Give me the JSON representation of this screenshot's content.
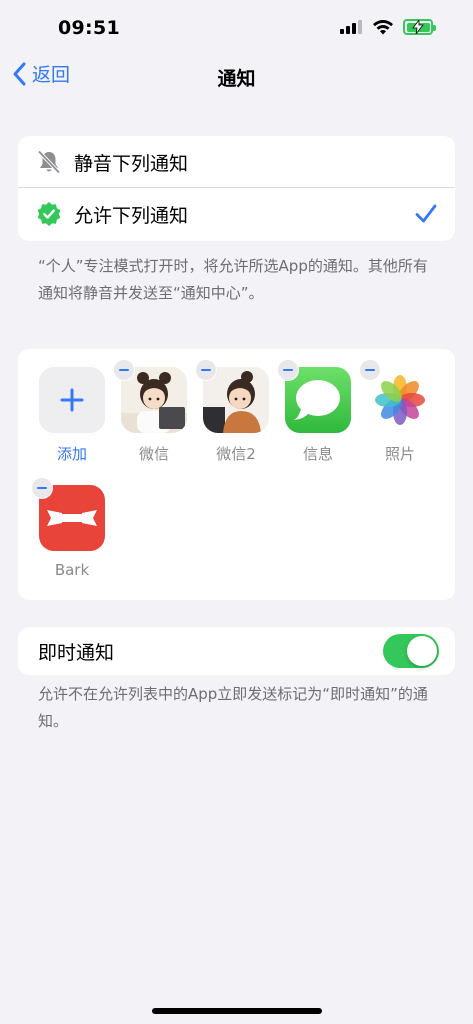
{
  "status_bar": {
    "time": "09:51"
  },
  "nav": {
    "back_label": "返回",
    "title": "通知"
  },
  "mode": {
    "options": [
      {
        "label": "静音下列通知",
        "icon": "bell-slash-icon"
      },
      {
        "label": "允许下列通知",
        "icon": "verified-badge-icon",
        "selected": true
      }
    ]
  },
  "mode_footer": "“个人”专注模式打开时，将允许所选App的通知。其他所有通知将静音并发送至“通知中心”。",
  "apps": [
    {
      "label": "添加",
      "icon": "plus-icon"
    },
    {
      "label": "微信",
      "icon": "wechat-avatar-icon"
    },
    {
      "label": "微信2",
      "icon": "wechat2-avatar-icon"
    },
    {
      "label": "信息",
      "icon": "messages-icon"
    },
    {
      "label": "照片",
      "icon": "photos-icon"
    },
    {
      "label": "Bark",
      "icon": "bark-icon"
    }
  ],
  "time_sensitive": {
    "label": "即时通知",
    "enabled": true
  },
  "time_sensitive_footer": "允许不在允许列表中的App立即发送标记为“即时通知”的通知。",
  "colors": {
    "accent": "#3478f6",
    "toggle_on": "#34c759",
    "background": "#f2f2f7"
  }
}
